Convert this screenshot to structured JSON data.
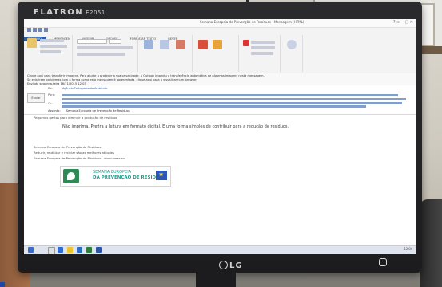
{
  "monitor": {
    "brand": "FLATRON",
    "model": "E2051",
    "logo": "LG"
  },
  "outlook": {
    "window_title": "Semana Europeia de Prevenção de Resíduos - Mensagem (HTML)",
    "tabs": [
      "FICHEIRO",
      "MENSAGEM",
      "INSERIR",
      "OPÇÕES",
      "FORMATAR TEXTO",
      "REVER"
    ],
    "info_lines": [
      "Clique aqui para transferir imagens. Para ajudar a proteger a sua privacidade, o Outlook impediu a transferência automática de algumas imagens nesta mensagem.",
      "Se existirem problemas com a forma como esta mensagem é apresentada, clique aqui para a visualizar num browser.",
      "Enviada segunda-feira 16/11/2015 12:03"
    ],
    "header": {
      "from_label": "De:",
      "from_value": "Agência Portuguesa do Ambiente",
      "to_label": "Para:",
      "cc_label": "Cc:",
      "send_label": "Enviar",
      "subject_label": "Assunto:",
      "subject_value": "Semana Europeia de Prevenção de Resíduos"
    },
    "body": {
      "line1": "Pequenos gestos para diminuir a produção de resíduos",
      "main": "Não imprima. Prefira a leitura em formato digital. É uma forma simples de contribuir para a redução de resíduos.",
      "line2": "Semana Europeia de Prevenção de Resíduos",
      "line3": "Reduzir, reutilizar e reciclar são as melhores atitudes",
      "line4": "Semana Europeia de Prevenção de Resíduos - www.ewwr.eu",
      "banner_line1": "SEMANA EUROPEIA",
      "banner_line2": "DA PREVENÇÃO DE RESÍDUOS"
    },
    "clock": "12:04"
  }
}
